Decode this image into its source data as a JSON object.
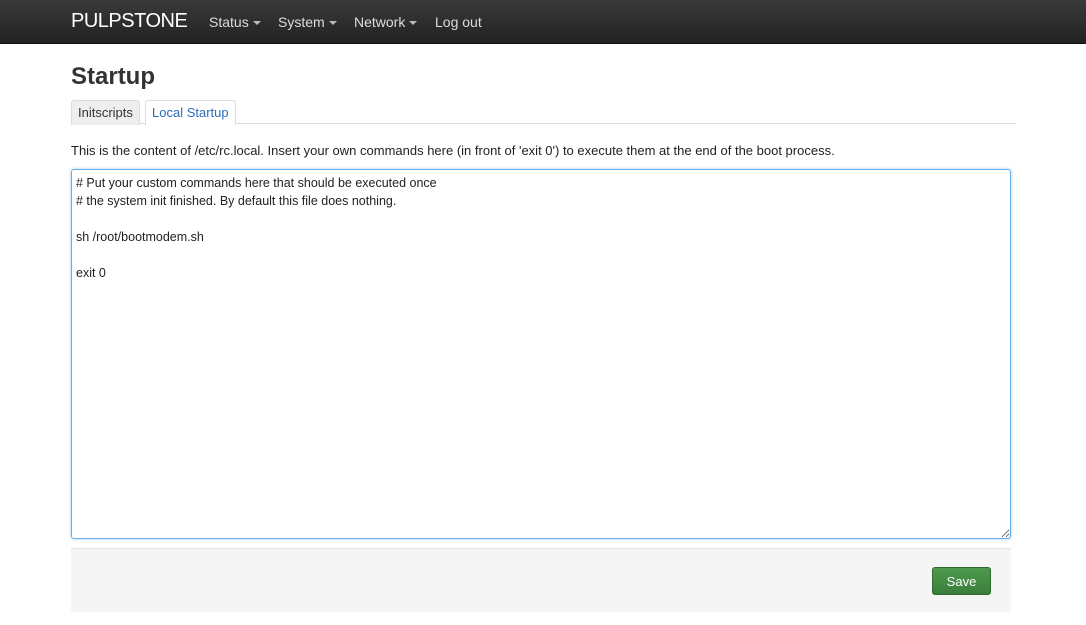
{
  "navbar": {
    "brand": "PULPSTONE",
    "items": [
      {
        "label": "Status",
        "dropdown": true
      },
      {
        "label": "System",
        "dropdown": true
      },
      {
        "label": "Network",
        "dropdown": true
      },
      {
        "label": "Log out",
        "dropdown": false
      }
    ]
  },
  "page": {
    "title": "Startup",
    "tabs": [
      {
        "label": "Initscripts",
        "active": false
      },
      {
        "label": "Local Startup",
        "active": true
      }
    ],
    "description": "This is the content of /etc/rc.local. Insert your own commands here (in front of 'exit 0') to execute them at the end of the boot process.",
    "editor_content": "# Put your custom commands here that should be executed once\n# the system init finished. By default this file does nothing.\n\nsh /root/bootmodem.sh\n\nexit 0"
  },
  "footer": {
    "save_label": "Save"
  },
  "colors": {
    "navbar_bg": "#2b2b2b",
    "active_tab_text": "#2a6ebb",
    "save_button": "#3a7d3a",
    "editor_focus_border": "#66afe9"
  }
}
